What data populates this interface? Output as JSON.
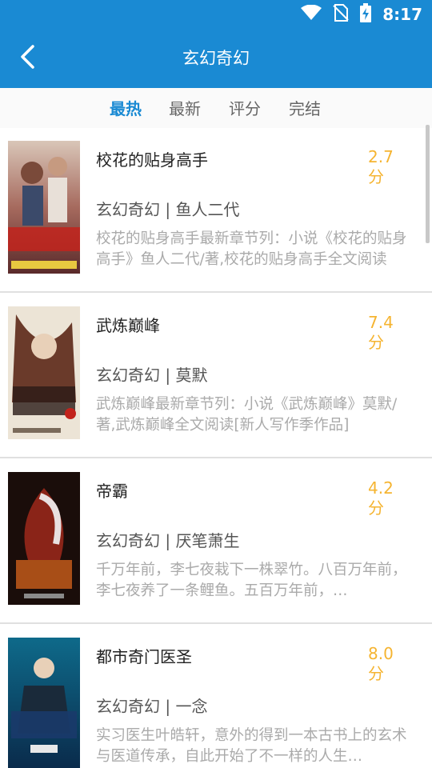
{
  "status": {
    "time": "8:17"
  },
  "header": {
    "title": "玄幻奇幻"
  },
  "tabs": [
    {
      "label": "最热"
    },
    {
      "label": "最新"
    },
    {
      "label": "评分"
    },
    {
      "label": "完结"
    }
  ],
  "books": [
    {
      "title": "校花的贴身高手",
      "score": "2.7",
      "score_unit": "分",
      "category": "玄幻奇幻",
      "author": "鱼人二代",
      "description": "校花的贴身高手最新章节列：小说《校花的贴身高手》鱼人二代/著,校花的贴身高手全文阅读"
    },
    {
      "title": "武炼巅峰",
      "score": "7.4",
      "score_unit": "分",
      "category": "玄幻奇幻",
      "author": "莫默",
      "description": "武炼巅峰最新章节列：小说《武炼巅峰》莫默/著,武炼巅峰全文阅读[新人写作季作品]"
    },
    {
      "title": "帝霸",
      "score": "4.2",
      "score_unit": "分",
      "category": "玄幻奇幻",
      "author": "厌笔萧生",
      "description": "千万年前，李七夜栽下一株翠竹。八百万年前，李七夜养了一条鲤鱼。五百万年前，…"
    },
    {
      "title": "都市奇门医圣",
      "score": "8.0",
      "score_unit": "分",
      "category": "玄幻奇幻",
      "author": "一念",
      "description": "实习医生叶皓轩，意外的得到一本古书上的玄术与医道传承，自此开始了不一样的人生…"
    }
  ],
  "colors": {
    "primary": "#1a8ad3",
    "score": "#f5b431"
  }
}
